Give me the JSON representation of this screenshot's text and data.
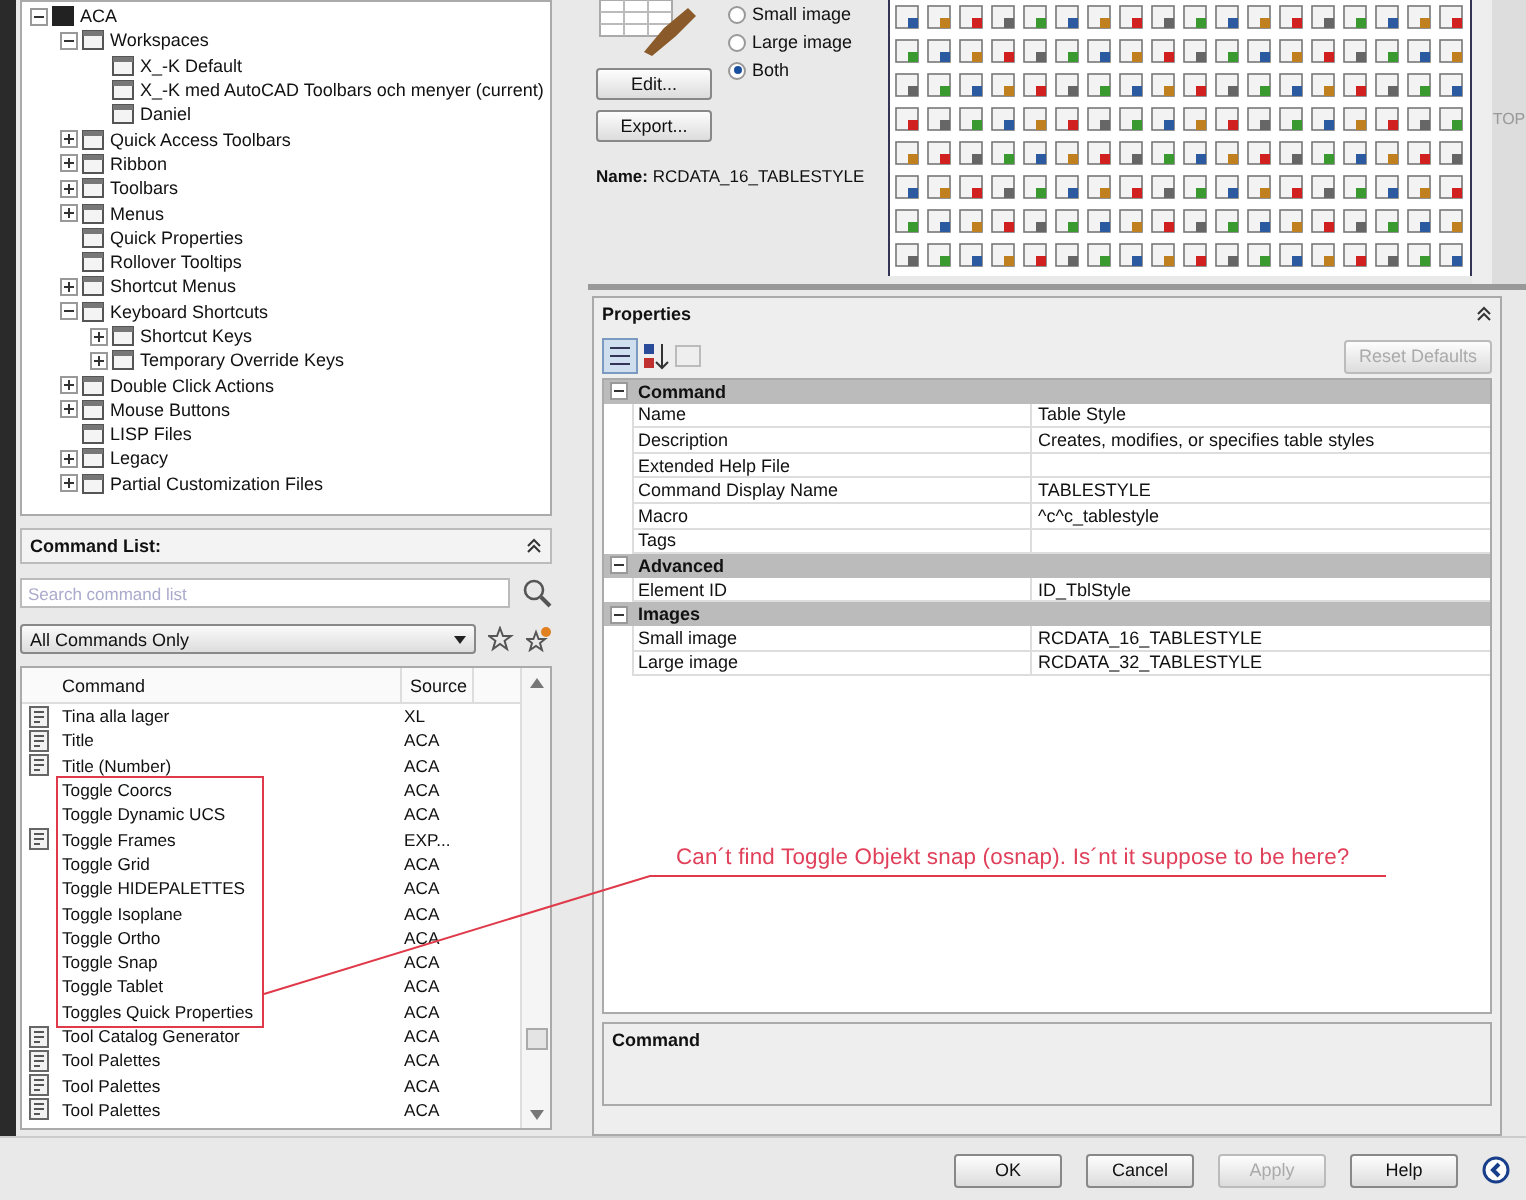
{
  "tree": [
    {
      "label": "ACA",
      "kind": "node",
      "expanded": true,
      "children": [
        {
          "label": "Workspaces",
          "kind": "node",
          "expanded": true,
          "children": [
            {
              "label": "X_-K Default",
              "kind": "leaf"
            },
            {
              "label": "X_-K med AutoCAD Toolbars och menyer (current)",
              "kind": "leaf"
            },
            {
              "label": "Daniel",
              "kind": "leaf"
            }
          ]
        },
        {
          "label": "Quick Access Toolbars",
          "kind": "node",
          "expanded": false
        },
        {
          "label": "Ribbon",
          "kind": "node",
          "expanded": false
        },
        {
          "label": "Toolbars",
          "kind": "node",
          "expanded": false
        },
        {
          "label": "Menus",
          "kind": "node",
          "expanded": false
        },
        {
          "label": "Quick Properties",
          "kind": "leaf"
        },
        {
          "label": "Rollover Tooltips",
          "kind": "leaf"
        },
        {
          "label": "Shortcut Menus",
          "kind": "node",
          "expanded": false
        },
        {
          "label": "Keyboard Shortcuts",
          "kind": "node",
          "expanded": true,
          "children": [
            {
              "label": "Shortcut Keys",
              "kind": "node",
              "expanded": false
            },
            {
              "label": "Temporary Override Keys",
              "kind": "node",
              "expanded": false
            }
          ]
        },
        {
          "label": "Double Click Actions",
          "kind": "node",
          "expanded": false
        },
        {
          "label": "Mouse Buttons",
          "kind": "node",
          "expanded": false
        },
        {
          "label": "LISP Files",
          "kind": "leaf"
        },
        {
          "label": "Legacy",
          "kind": "node",
          "expanded": false
        },
        {
          "label": "Partial Customization Files",
          "kind": "node",
          "expanded": false
        }
      ]
    }
  ],
  "command_list": {
    "title": "Command List:",
    "search": {
      "placeholder": "Search command list"
    },
    "filter": "All Commands Only",
    "columns": [
      "Command",
      "Source"
    ],
    "rows": [
      {
        "command": "Tina alla lager",
        "source": "XL",
        "icon": true
      },
      {
        "command": "Title",
        "source": "ACA",
        "icon": true
      },
      {
        "command": "Title (Number)",
        "source": "ACA",
        "icon": true
      },
      {
        "command": "Toggle Coorcs",
        "source": "ACA",
        "icon": false
      },
      {
        "command": "Toggle Dynamic UCS",
        "source": "ACA",
        "icon": false
      },
      {
        "command": "Toggle Frames",
        "source": "EXP...",
        "icon": true
      },
      {
        "command": "Toggle Grid",
        "source": "ACA",
        "icon": false
      },
      {
        "command": "Toggle HIDEPALETTES",
        "source": "ACA",
        "icon": false
      },
      {
        "command": "Toggle Isoplane",
        "source": "ACA",
        "icon": false
      },
      {
        "command": "Toggle Ortho",
        "source": "ACA",
        "icon": false
      },
      {
        "command": "Toggle Snap",
        "source": "ACA",
        "icon": false
      },
      {
        "command": "Toggle Tablet",
        "source": "ACA",
        "icon": false
      },
      {
        "command": "Toggles Quick Properties",
        "source": "ACA",
        "icon": false
      },
      {
        "command": "Tool Catalog Generator",
        "source": "ACA",
        "icon": true
      },
      {
        "command": "Tool Palettes",
        "source": "ACA",
        "icon": true
      },
      {
        "command": "Tool Palettes",
        "source": "ACA",
        "icon": true
      },
      {
        "command": "Tool Palettes",
        "source": "ACA",
        "icon": true
      }
    ]
  },
  "image_panel": {
    "radios": [
      {
        "label": "Small image",
        "selected": false
      },
      {
        "label": "Large image",
        "selected": false
      },
      {
        "label": "Both",
        "selected": true
      }
    ],
    "buttons": [
      "Edit...",
      "Export..."
    ],
    "name_label": "Name:",
    "name_value": "RCDATA_16_TABLESTYLE"
  },
  "side_label": "TOP",
  "properties": {
    "title": "Properties",
    "reset_button": "Reset Defaults",
    "categories": [
      {
        "label": "Command",
        "expanded": true,
        "rows": [
          {
            "name": "Name",
            "value": "Table Style"
          },
          {
            "name": "Description",
            "value": "Creates, modifies, or specifies table styles"
          },
          {
            "name": "Extended Help File",
            "value": ""
          },
          {
            "name": "Command Display Name",
            "value": "TABLESTYLE"
          },
          {
            "name": "Macro",
            "value": "^c^c_tablestyle"
          },
          {
            "name": "Tags",
            "value": ""
          }
        ]
      },
      {
        "label": "Advanced",
        "expanded": true,
        "rows": [
          {
            "name": "Element ID",
            "value": "ID_TblStyle"
          }
        ]
      },
      {
        "label": "Images",
        "expanded": true,
        "rows": [
          {
            "name": "Small image",
            "value": "RCDATA_16_TABLESTYLE"
          },
          {
            "name": "Large image",
            "value": "RCDATA_32_TABLESTYLE"
          }
        ]
      }
    ],
    "description_title": "Command"
  },
  "annotation": "Can´t find Toggle Objekt snap (osnap). Is´nt it suppose to be here?",
  "buttons": [
    {
      "label": "OK",
      "disabled": false
    },
    {
      "label": "Cancel",
      "disabled": false
    },
    {
      "label": "Apply",
      "disabled": true
    },
    {
      "label": "Help",
      "disabled": false
    }
  ]
}
